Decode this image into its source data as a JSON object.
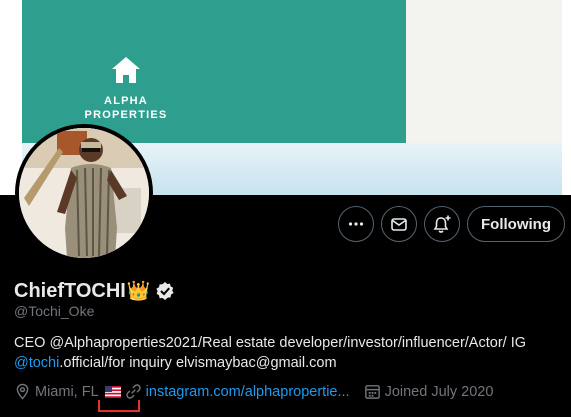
{
  "banner": {
    "logo_line1": "ALPHA",
    "logo_line2": "PROPERTIES",
    "brand_color": "#2e9f8e"
  },
  "actions": {
    "more_icon": "more-horizontal-icon",
    "message_icon": "envelope-icon",
    "notify_icon": "bell-plus-icon",
    "following_label": "Following"
  },
  "profile": {
    "display_name": "ChiefTOCHI",
    "crown_emoji": "👑",
    "verified_icon": "verified-badge-icon",
    "handle": "@Tochi_Oke",
    "bio": {
      "part1": "CEO @Alphaproperties2021/Real estate developer/investor/influencer/Actor/ IG",
      "mention": "@tochi",
      "part2": ".official/for inquiry elvismaybac@gmail.com"
    },
    "location": "Miami, FL",
    "website": "instagram.com/alphapropertie...",
    "joined": "Joined July 2020"
  },
  "colors": {
    "link": "#1d9bf0",
    "secondary_text": "#71767b",
    "border": "#536471",
    "annotation": "#e3312d"
  }
}
